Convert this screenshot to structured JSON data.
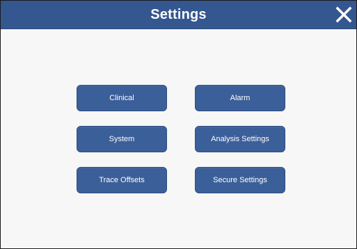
{
  "header": {
    "title": "Settings",
    "close_icon": "close-icon"
  },
  "menu": {
    "clinical": "Clinical",
    "alarm": "Alarm",
    "system": "System",
    "analysis_settings": "Analysis Settings",
    "trace_offsets": "Trace Offsets",
    "secure_settings": "Secure Settings"
  },
  "colors": {
    "header_bg": "#355790",
    "button_bg": "#3b5f99",
    "background": "#f7f7f7",
    "text": "#ffffff"
  }
}
